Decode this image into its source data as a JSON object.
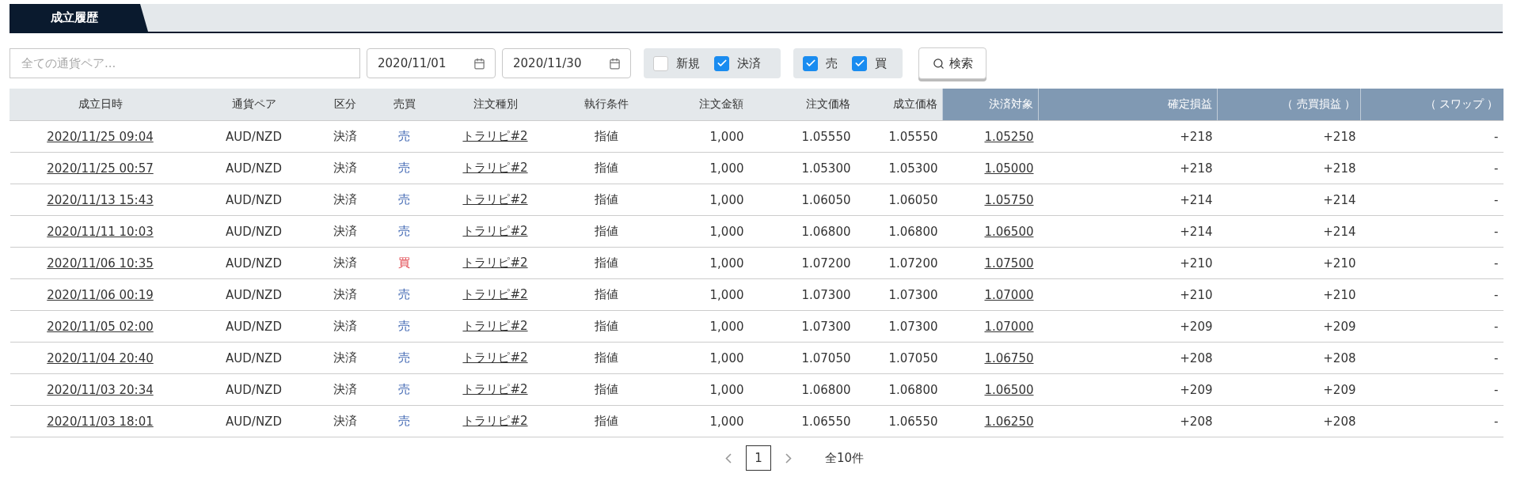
{
  "tabs": [
    {
      "label": "成立履歴",
      "selected": true
    }
  ],
  "filters": {
    "pair_placeholder": "全ての通貨ペア...",
    "date_from": "2020/11/01",
    "date_to": "2020/11/30",
    "type_checks": [
      {
        "label": "新規",
        "checked": false
      },
      {
        "label": "決済",
        "checked": true
      }
    ],
    "side_checks": [
      {
        "label": "売",
        "checked": true
      },
      {
        "label": "買",
        "checked": true
      }
    ],
    "search_button": "検索"
  },
  "table": {
    "columns": [
      "成立日時",
      "通貨ペア",
      "区分",
      "売買",
      "注文種別",
      "執行条件",
      "注文金額",
      "注文価格",
      "成立価格",
      "決済対象",
      "確定損益",
      "（ 売買損益 ）",
      "（ スワップ ）"
    ],
    "rows": [
      {
        "datetime": "2020/11/25 09:04",
        "pair": "AUD/NZD",
        "category": "決済",
        "side": "売",
        "kind": "sell",
        "order_type": "トラリピ#2",
        "condition": "指値",
        "amount": "1,000",
        "order_price": "1.05550",
        "fill_price": "1.05550",
        "settle_target": "1.05250",
        "realized": "+218",
        "trade_pl": "+218",
        "swap": "-"
      },
      {
        "datetime": "2020/11/25 00:57",
        "pair": "AUD/NZD",
        "category": "決済",
        "side": "売",
        "kind": "sell",
        "order_type": "トラリピ#2",
        "condition": "指値",
        "amount": "1,000",
        "order_price": "1.05300",
        "fill_price": "1.05300",
        "settle_target": "1.05000",
        "realized": "+218",
        "trade_pl": "+218",
        "swap": "-"
      },
      {
        "datetime": "2020/11/13 15:43",
        "pair": "AUD/NZD",
        "category": "決済",
        "side": "売",
        "kind": "sell",
        "order_type": "トラリピ#2",
        "condition": "指値",
        "amount": "1,000",
        "order_price": "1.06050",
        "fill_price": "1.06050",
        "settle_target": "1.05750",
        "realized": "+214",
        "trade_pl": "+214",
        "swap": "-"
      },
      {
        "datetime": "2020/11/11 10:03",
        "pair": "AUD/NZD",
        "category": "決済",
        "side": "売",
        "kind": "sell",
        "order_type": "トラリピ#2",
        "condition": "指値",
        "amount": "1,000",
        "order_price": "1.06800",
        "fill_price": "1.06800",
        "settle_target": "1.06500",
        "realized": "+214",
        "trade_pl": "+214",
        "swap": "-"
      },
      {
        "datetime": "2020/11/06 10:35",
        "pair": "AUD/NZD",
        "category": "決済",
        "side": "買",
        "kind": "buy",
        "order_type": "トラリピ#2",
        "condition": "指値",
        "amount": "1,000",
        "order_price": "1.07200",
        "fill_price": "1.07200",
        "settle_target": "1.07500",
        "realized": "+210",
        "trade_pl": "+210",
        "swap": "-"
      },
      {
        "datetime": "2020/11/06 00:19",
        "pair": "AUD/NZD",
        "category": "決済",
        "side": "売",
        "kind": "sell",
        "order_type": "トラリピ#2",
        "condition": "指値",
        "amount": "1,000",
        "order_price": "1.07300",
        "fill_price": "1.07300",
        "settle_target": "1.07000",
        "realized": "+210",
        "trade_pl": "+210",
        "swap": "-"
      },
      {
        "datetime": "2020/11/05 02:00",
        "pair": "AUD/NZD",
        "category": "決済",
        "side": "売",
        "kind": "sell",
        "order_type": "トラリピ#2",
        "condition": "指値",
        "amount": "1,000",
        "order_price": "1.07300",
        "fill_price": "1.07300",
        "settle_target": "1.07000",
        "realized": "+209",
        "trade_pl": "+209",
        "swap": "-"
      },
      {
        "datetime": "2020/11/04 20:40",
        "pair": "AUD/NZD",
        "category": "決済",
        "side": "売",
        "kind": "sell",
        "order_type": "トラリピ#2",
        "condition": "指値",
        "amount": "1,000",
        "order_price": "1.07050",
        "fill_price": "1.07050",
        "settle_target": "1.06750",
        "realized": "+208",
        "trade_pl": "+208",
        "swap": "-"
      },
      {
        "datetime": "2020/11/03 20:34",
        "pair": "AUD/NZD",
        "category": "決済",
        "side": "売",
        "kind": "sell",
        "order_type": "トラリピ#2",
        "condition": "指値",
        "amount": "1,000",
        "order_price": "1.06800",
        "fill_price": "1.06800",
        "settle_target": "1.06500",
        "realized": "+209",
        "trade_pl": "+209",
        "swap": "-"
      },
      {
        "datetime": "2020/11/03 18:01",
        "pair": "AUD/NZD",
        "category": "決済",
        "side": "売",
        "kind": "sell",
        "order_type": "トラリピ#2",
        "condition": "指値",
        "amount": "1,000",
        "order_price": "1.06550",
        "fill_price": "1.06550",
        "settle_target": "1.06250",
        "realized": "+208",
        "trade_pl": "+208",
        "swap": "-"
      }
    ]
  },
  "pagination": {
    "pages": [
      {
        "label": "1",
        "selected": true
      }
    ],
    "total": "全10件"
  }
}
